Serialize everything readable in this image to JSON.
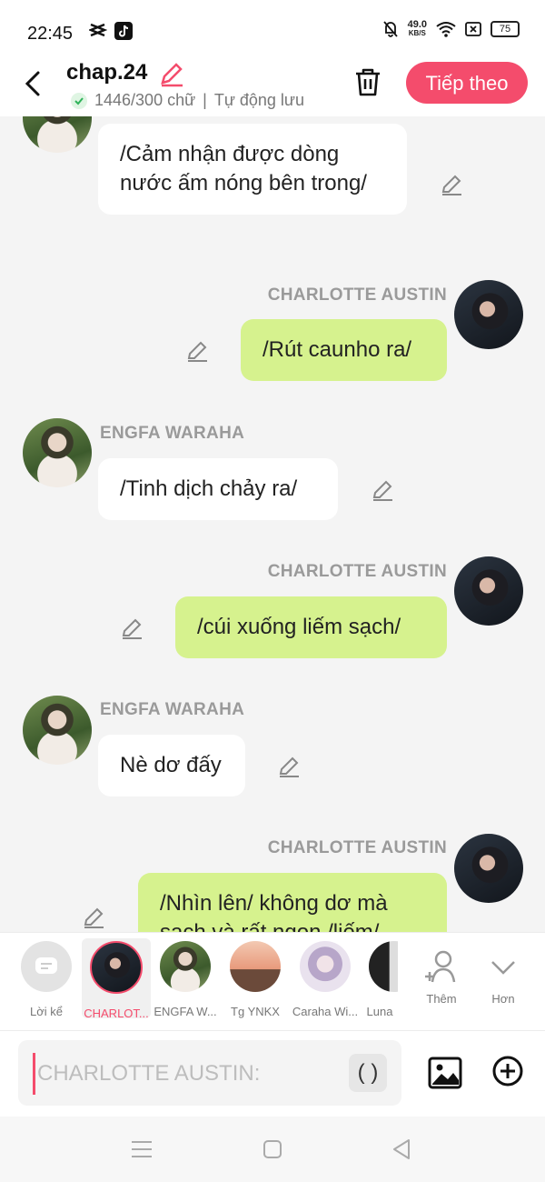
{
  "status": {
    "time": "22:45",
    "net_speed": "49.0",
    "net_unit": "KB/S",
    "battery": "75"
  },
  "header": {
    "title": "chap.24",
    "word_count": "1446/300 chữ",
    "autosave": "Tự động lưu",
    "next_label": "Tiếp theo"
  },
  "messages": [
    {
      "side": "left",
      "speaker": "",
      "text": "/Cảm nhận được dòng nước ấm nóng bên trong/"
    },
    {
      "side": "right",
      "speaker": "CHARLOTTE AUSTIN",
      "text": "/Rút caunho ra/"
    },
    {
      "side": "left",
      "speaker": "ENGFA WARAHA",
      "text": "/Tinh dịch chảy ra/"
    },
    {
      "side": "right",
      "speaker": "CHARLOTTE AUSTIN",
      "text": "/cúi xuống liếm sạch/"
    },
    {
      "side": "left",
      "speaker": "ENGFA WARAHA",
      "text": "Nè dơ đấy"
    },
    {
      "side": "right",
      "speaker": "CHARLOTTE AUSTIN",
      "text": "/Nhìn lên/ không dơ mà sạch và rất ngọn /liếm/"
    }
  ],
  "characters": [
    {
      "label": "Lời kể"
    },
    {
      "label": "CHARLOT..."
    },
    {
      "label": "ENGFA W..."
    },
    {
      "label": "Tg YNKX"
    },
    {
      "label": "Caraha Wi..."
    },
    {
      "label": "Luna"
    }
  ],
  "more": {
    "add_label": "Thêm",
    "more_label": "Hơn"
  },
  "input": {
    "placeholder": "CHARLOTTE AUSTIN:",
    "paren": "( )"
  },
  "colors": {
    "accent": "#f44c6c",
    "bubble_right": "#d6f28e"
  }
}
